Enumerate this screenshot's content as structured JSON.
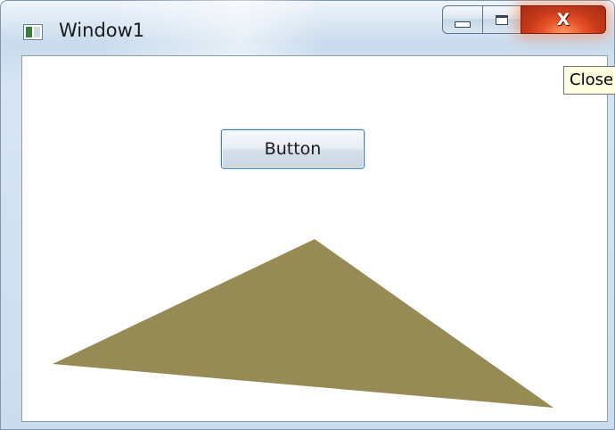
{
  "window": {
    "title": "Window1",
    "app_icon": "window-app-icon"
  },
  "caption_buttons": {
    "minimize_icon": "minimize-icon",
    "maximize_icon": "maximize-icon",
    "close_icon": "close-icon",
    "close_glyph": "X"
  },
  "tooltip": {
    "text": "Close"
  },
  "content": {
    "button_label": "Button",
    "triangle_fill": "#968b54"
  },
  "colors": {
    "close_red": "#c63a1a",
    "button_border": "#3c7fb1",
    "tooltip_bg": "#ffffe1"
  }
}
